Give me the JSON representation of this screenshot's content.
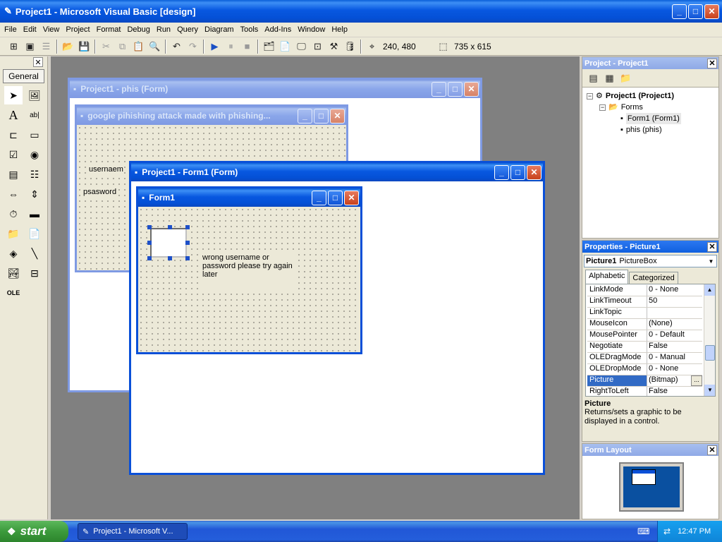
{
  "app": {
    "title": "Project1 - Microsoft Visual Basic [design]"
  },
  "menu": [
    "File",
    "Edit",
    "View",
    "Project",
    "Format",
    "Debug",
    "Run",
    "Query",
    "Diagram",
    "Tools",
    "Add-Ins",
    "Window",
    "Help"
  ],
  "toolbar": {
    "position": "240, 480",
    "size": "735 x 615"
  },
  "toolbox": {
    "tab": "General"
  },
  "forms": {
    "phis": {
      "title": "Project1 - phis (Form)",
      "inner_title": "google pihishing attack made with phishing...",
      "label_user": "usernaem",
      "label_pass": "psasword"
    },
    "form1": {
      "title": "Project1 - Form1 (Form)",
      "inner_title": "Form1",
      "message": "wrong username or password please try again later"
    }
  },
  "project": {
    "title": "Project - Project1",
    "root": "Project1 (Project1)",
    "folder": "Forms",
    "items": [
      "Form1 (Form1)",
      "phis (phis)"
    ]
  },
  "properties": {
    "title": "Properties - Picture1",
    "object_name": "Picture1",
    "object_type": "PictureBox",
    "tabs": [
      "Alphabetic",
      "Categorized"
    ],
    "rows": [
      {
        "name": "LinkMode",
        "value": "0 - None"
      },
      {
        "name": "LinkTimeout",
        "value": "50"
      },
      {
        "name": "LinkTopic",
        "value": ""
      },
      {
        "name": "MouseIcon",
        "value": "(None)"
      },
      {
        "name": "MousePointer",
        "value": "0 - Default"
      },
      {
        "name": "Negotiate",
        "value": "False"
      },
      {
        "name": "OLEDragMode",
        "value": "0 - Manual"
      },
      {
        "name": "OLEDropMode",
        "value": "0 - None"
      },
      {
        "name": "Picture",
        "value": "(Bitmap)"
      },
      {
        "name": "RightToLeft",
        "value": "False"
      }
    ],
    "selected_index": 8,
    "desc_title": "Picture",
    "desc_text": "Returns/sets a graphic to be displayed in a control."
  },
  "form_layout": {
    "title": "Form Layout"
  },
  "taskbar": {
    "start": "start",
    "task": "Project1 - Microsoft V...",
    "clock": "12:47 PM"
  },
  "colors": {
    "xp_blue": "#0a5fd8",
    "mdi_bg": "#808080",
    "start_green": "#3c9a3c"
  }
}
